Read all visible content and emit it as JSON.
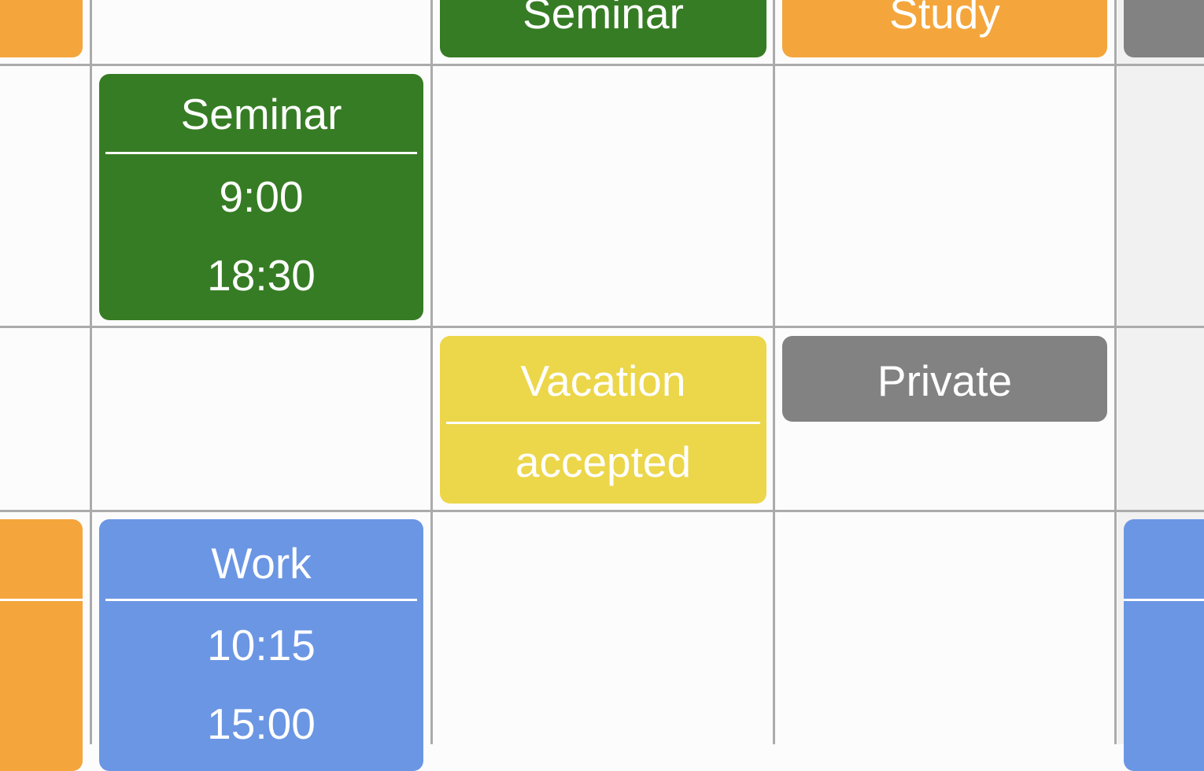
{
  "colors": {
    "seminar": "#367c24",
    "study": "#f4a63c",
    "private": "#828282",
    "vacation": "#ecd64a",
    "work": "#6b96e4",
    "grid_line": "#ababab",
    "cell_background": "#fcfcfc",
    "weekend_background": "#f1f1f1"
  },
  "row0": {
    "seminar": {
      "title": "Seminar"
    },
    "study": {
      "title": "Study"
    }
  },
  "row1": {
    "seminar": {
      "title": "Seminar",
      "start": "9:00",
      "end": "18:30"
    }
  },
  "row2": {
    "vacation": {
      "title": "Vacation",
      "status": "accepted"
    },
    "private": {
      "title": "Private"
    }
  },
  "row3": {
    "work": {
      "title": "Work",
      "start": "10:15",
      "end": "15:00"
    }
  }
}
